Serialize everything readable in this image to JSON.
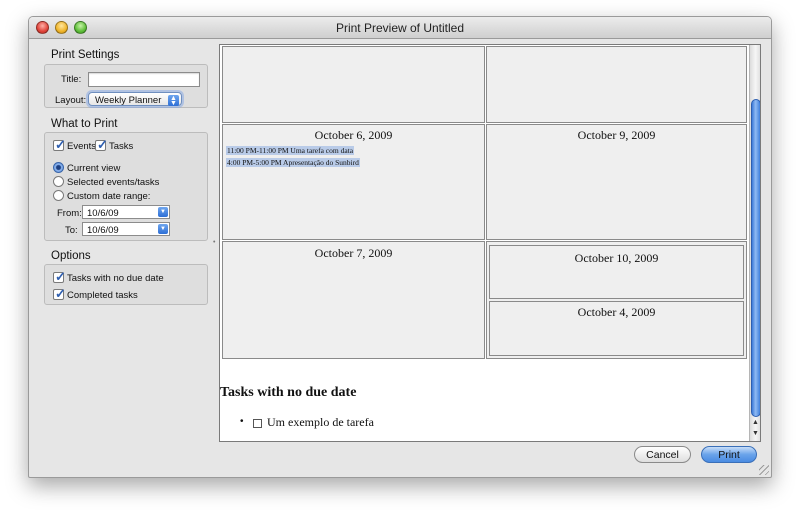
{
  "window": {
    "title": "Print Preview of Untitled"
  },
  "print_settings": {
    "heading": "Print Settings",
    "title_label": "Title:",
    "title_value": "",
    "layout_label": "Layout:",
    "layout_value": "Weekly Planner"
  },
  "what_to_print": {
    "heading": "What to Print",
    "events_label": "Events",
    "tasks_label": "Tasks",
    "radio_current": "Current view",
    "radio_selected": "Selected events/tasks",
    "radio_custom": "Custom date range:",
    "from_label": "From:",
    "from_value": "10/6/09",
    "to_label": "To:",
    "to_value": "10/6/09"
  },
  "options": {
    "heading": "Options",
    "no_due_label": "Tasks with no due date",
    "completed_label": "Completed tasks"
  },
  "preview": {
    "days": [
      {
        "date": "October 6, 2009",
        "events": [
          "11:00 PM-11:00 PM Uma tarefa com data",
          "4:00 PM-5:00 PM Apresentação do Sunbird"
        ]
      },
      {
        "date": "October 9, 2009",
        "events": []
      },
      {
        "date": "October 7, 2009",
        "events": []
      },
      {
        "date": "October 10, 2009",
        "events": []
      },
      {
        "date": "October 4, 2009",
        "events": []
      }
    ],
    "tasks_heading": "Tasks with no due date",
    "tasks": [
      "Um exemplo de tarefa"
    ]
  },
  "buttons": {
    "cancel": "Cancel",
    "print": "Print"
  },
  "colors": {
    "accent": "#4a8be2",
    "event_highlight": "#b9cbe8"
  }
}
